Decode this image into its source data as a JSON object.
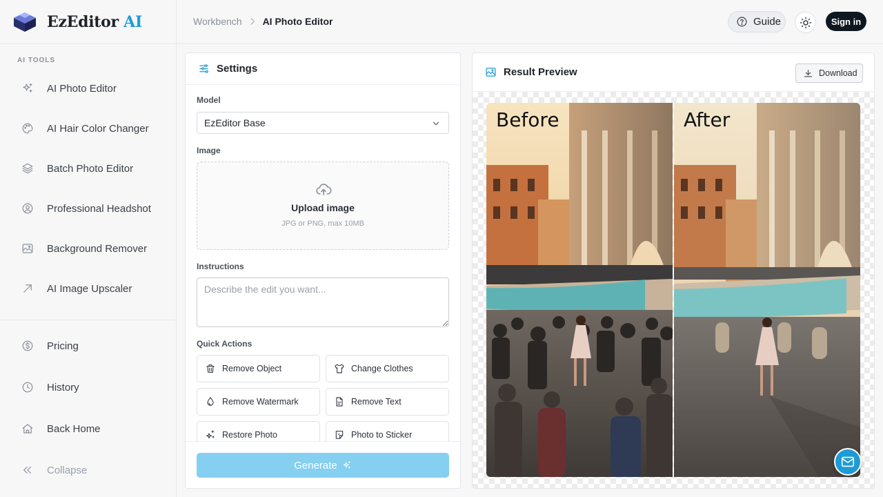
{
  "brand": {
    "name": "EzEditor",
    "accent": "AI",
    "accent_color": "#1d9bd7"
  },
  "sidebar": {
    "section_label": "AI TOOLS",
    "tools": [
      {
        "label": "AI Photo Editor",
        "icon": "sparkles-icon"
      },
      {
        "label": "AI Hair Color Changer",
        "icon": "palette-icon"
      },
      {
        "label": "Batch Photo Editor",
        "icon": "layers-icon"
      },
      {
        "label": "Professional Headshot",
        "icon": "user-circle-icon"
      },
      {
        "label": "Background Remover",
        "icon": "image-icon"
      },
      {
        "label": "AI Image Upscaler",
        "icon": "arrow-up-right-icon"
      }
    ],
    "bottom": [
      {
        "label": "Pricing",
        "icon": "dollar-icon"
      },
      {
        "label": "History",
        "icon": "clock-icon"
      },
      {
        "label": "Back Home",
        "icon": "home-icon"
      },
      {
        "label": "Collapse",
        "icon": "chevrons-left-icon"
      }
    ]
  },
  "header": {
    "breadcrumb": [
      "Workbench",
      "AI Photo Editor"
    ],
    "guide_label": "Guide",
    "signin_label": "Sign in"
  },
  "settings": {
    "title": "Settings",
    "model_label": "Model",
    "model_value": "EzEditor Base",
    "image_label": "Image",
    "upload_title": "Upload image",
    "upload_hint": "JPG or PNG, max 10MB",
    "instructions_label": "Instructions",
    "instructions_placeholder": "Describe the edit you want...",
    "quick_actions_label": "Quick Actions",
    "quick_actions": [
      {
        "label": "Remove Object",
        "icon": "trash-icon"
      },
      {
        "label": "Change Clothes",
        "icon": "shirt-icon"
      },
      {
        "label": "Remove Watermark",
        "icon": "droplet-icon"
      },
      {
        "label": "Remove Text",
        "icon": "file-text-icon"
      },
      {
        "label": "Restore Photo",
        "icon": "sparkle-icon"
      },
      {
        "label": "Photo to Sticker",
        "icon": "sticker-icon"
      }
    ],
    "generate_label": "Generate"
  },
  "preview": {
    "title": "Result Preview",
    "download_label": "Download",
    "before_label": "Before",
    "after_label": "After"
  }
}
